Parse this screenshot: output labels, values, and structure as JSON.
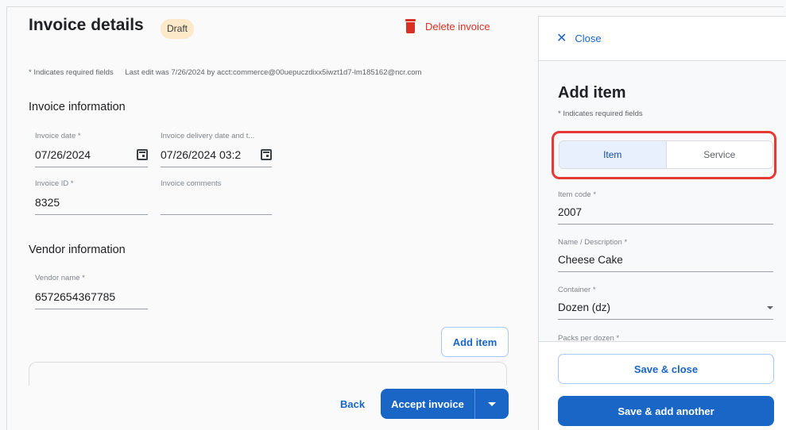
{
  "invoice": {
    "title": "Invoice details",
    "status_badge": "Draft",
    "delete_label": "Delete invoice",
    "required_note": "* Indicates required fields",
    "last_edit": "Last edit was 7/26/2024 by acct:commerce@00uepuczdixx5iwzt1d7-lm185162@ncr.com",
    "invoice_info_title": "Invoice information",
    "invoice_date_label": "Invoice date *",
    "invoice_date_value": "07/26/2024",
    "delivery_date_label": "Invoice delivery date and t...",
    "delivery_date_value": "07/26/2024 03:2",
    "invoice_id_label": "Invoice ID *",
    "invoice_id_value": "8325",
    "comments_label": "Invoice comments",
    "comments_value": "",
    "vendor_info_title": "Vendor information",
    "vendor_name_label": "Vendor name *",
    "vendor_name_value": "6572654367785",
    "add_item_label": "Add item",
    "back_label": "Back",
    "accept_label": "Accept invoice"
  },
  "panel": {
    "close_label": "Close",
    "title": "Add item",
    "required_note": "* Indicates required fields",
    "segments": [
      "Item",
      "Service"
    ],
    "active_segment": "Item",
    "item_code_label": "Item code *",
    "item_code_value": "2007",
    "name_label": "Name / Description *",
    "name_value": "Cheese Cake",
    "container_label": "Container *",
    "container_value": "Dozen (dz)",
    "packs_label": "Packs per dozen *",
    "save_close_label": "Save & close",
    "save_add_label": "Save & add another"
  },
  "colors": {
    "primary": "#1a66c7",
    "danger": "#d93025",
    "highlight": "#e53935",
    "draft_badge": "#fbe9c9"
  }
}
